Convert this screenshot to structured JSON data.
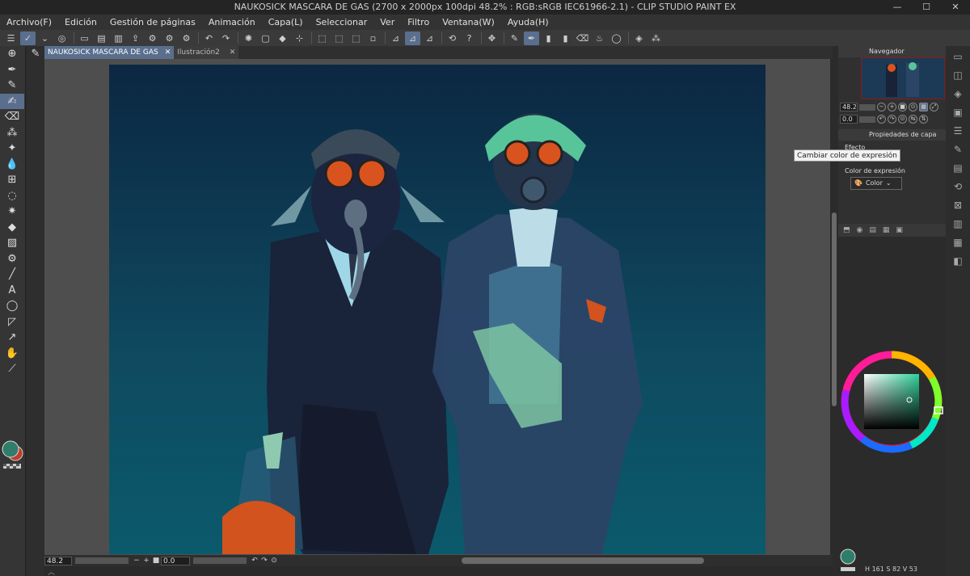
{
  "window": {
    "title": "NAUKOSICK MASCARA DE GAS (2700 x 2000px 100dpi 48.2% : RGB:sRGB IEC61966-2.1) - CLIP STUDIO PAINT EX",
    "min": "—",
    "max": "☐",
    "close": "✕"
  },
  "menu": [
    "Archivo(F)",
    "Edición",
    "Gestión de páginas",
    "Animación",
    "Capa(L)",
    "Seleccionar",
    "Ver",
    "Filtro",
    "Ventana(W)",
    "Ayuda(H)"
  ],
  "tabs": [
    {
      "label": "NAUKOSICK MASCARA DE GAS",
      "close": "✕"
    },
    {
      "label": "Ilustración2",
      "close": "✕"
    }
  ],
  "status": {
    "zoom": "48.2",
    "rotation": "0.0"
  },
  "navigator": {
    "title": "Navegador",
    "zoom": "48.2",
    "angle": "0.0"
  },
  "layer_properties": {
    "title": "Propiedades de capa",
    "effect_label": "Efecto",
    "expression_color_label": "Color de expresión",
    "expression_color_value": "Color",
    "tooltip": "Cambiar color de expresión"
  },
  "color_readout": {
    "h": "161",
    "s": "82",
    "v": "53"
  },
  "colors": {
    "accent": "#5a6f8e",
    "main_color": "#2f7d6a",
    "sub_color": "#c23b2a",
    "wheel_square": "#4a9a80"
  }
}
